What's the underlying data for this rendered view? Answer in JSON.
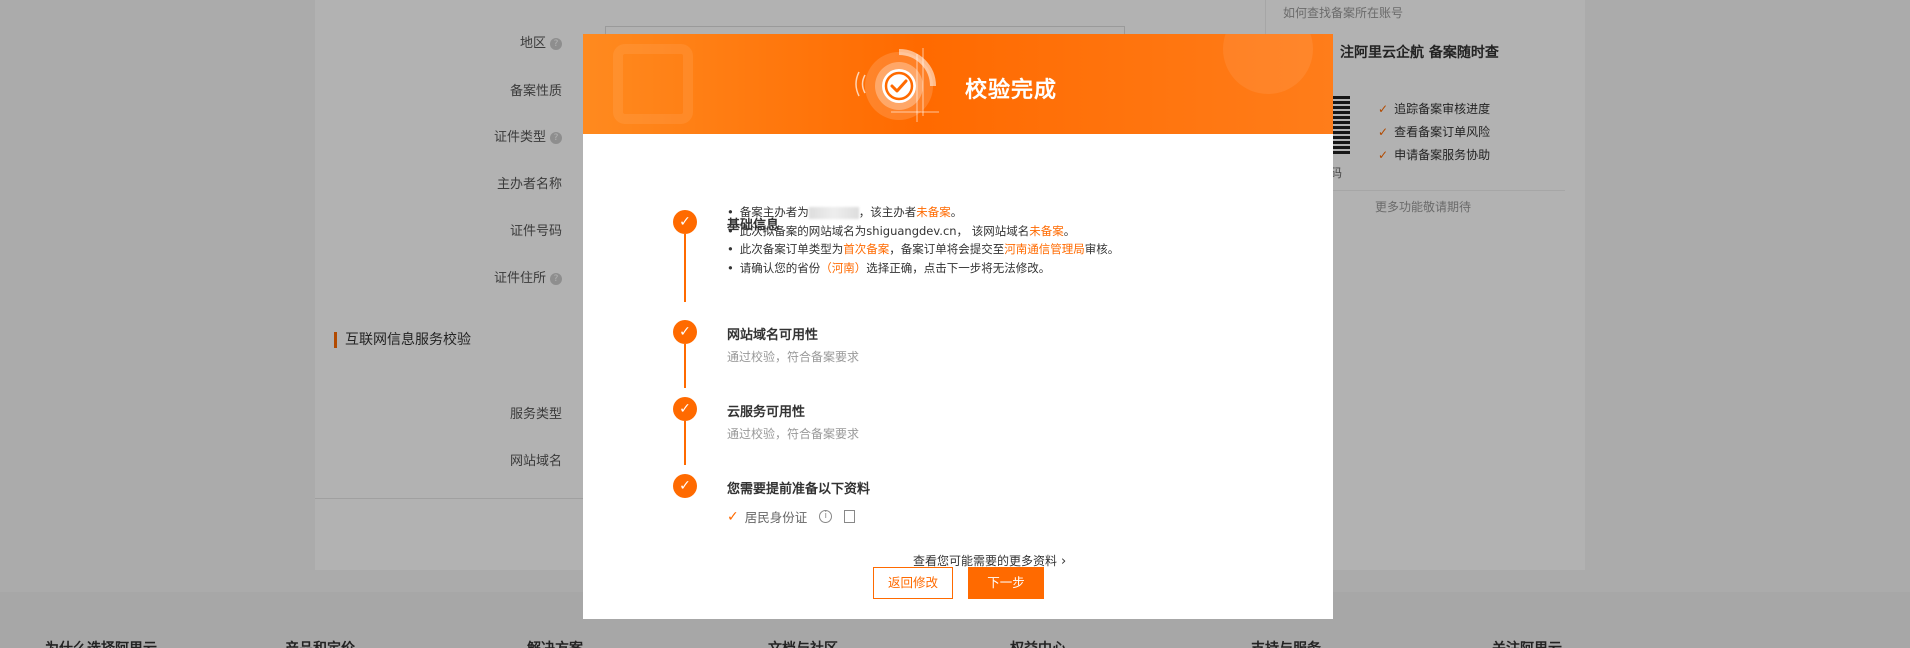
{
  "background": {
    "form_labels": [
      "地区",
      "备案性质",
      "证件类型",
      "主办者名称",
      "证件号码",
      "证件住所",
      "服务类型",
      "网站域名"
    ],
    "section_title": "互联网信息服务校验",
    "right_panel": {
      "top_link": "如何查找备案所在账号",
      "title": "注阿里云企航 备案随时查",
      "qr_caption": "码",
      "features": [
        "追踪备案审核进度",
        "查看备案订单风险",
        "申请备案服务协助"
      ],
      "more": "更多功能敬请期待"
    },
    "footer": [
      "为什么选择阿里云",
      "产品和定价",
      "解决方案",
      "文档与社区",
      "权益中心",
      "支持与服务",
      "关注阿里云"
    ]
  },
  "modal": {
    "title": "校验完成",
    "steps": [
      {
        "title": "基础信息",
        "bullets": [
          {
            "pre": "备案主办者为",
            "mid": "，该主办者",
            "hl": "未备案",
            "post": "。"
          },
          {
            "pre": "此次拟备案的网站域名为shiguangdev.cn， 该网站域名",
            "hl": "未备案",
            "post": "。"
          },
          {
            "pre": "此次备案订单类型为",
            "hl1": "首次备案",
            "mid": "，备案订单将会提交至",
            "hl2": "河南通信管理局",
            "post": "审核。"
          },
          {
            "pre": "请确认您的省份",
            "hl": "（河南）",
            "post": "选择正确，点击下一步将无法修改。"
          }
        ]
      },
      {
        "title": "网站域名可用性",
        "sub": "通过校验，符合备案要求"
      },
      {
        "title": "云服务可用性",
        "sub": "通过校验，符合备案要求"
      },
      {
        "title": "您需要提前准备以下资料",
        "doc": "居民身份证"
      }
    ],
    "more_link": "查看您可能需要的更多资料",
    "back_button": "返回修改",
    "next_button": "下一步",
    "accent_color": "#ff6a00"
  }
}
